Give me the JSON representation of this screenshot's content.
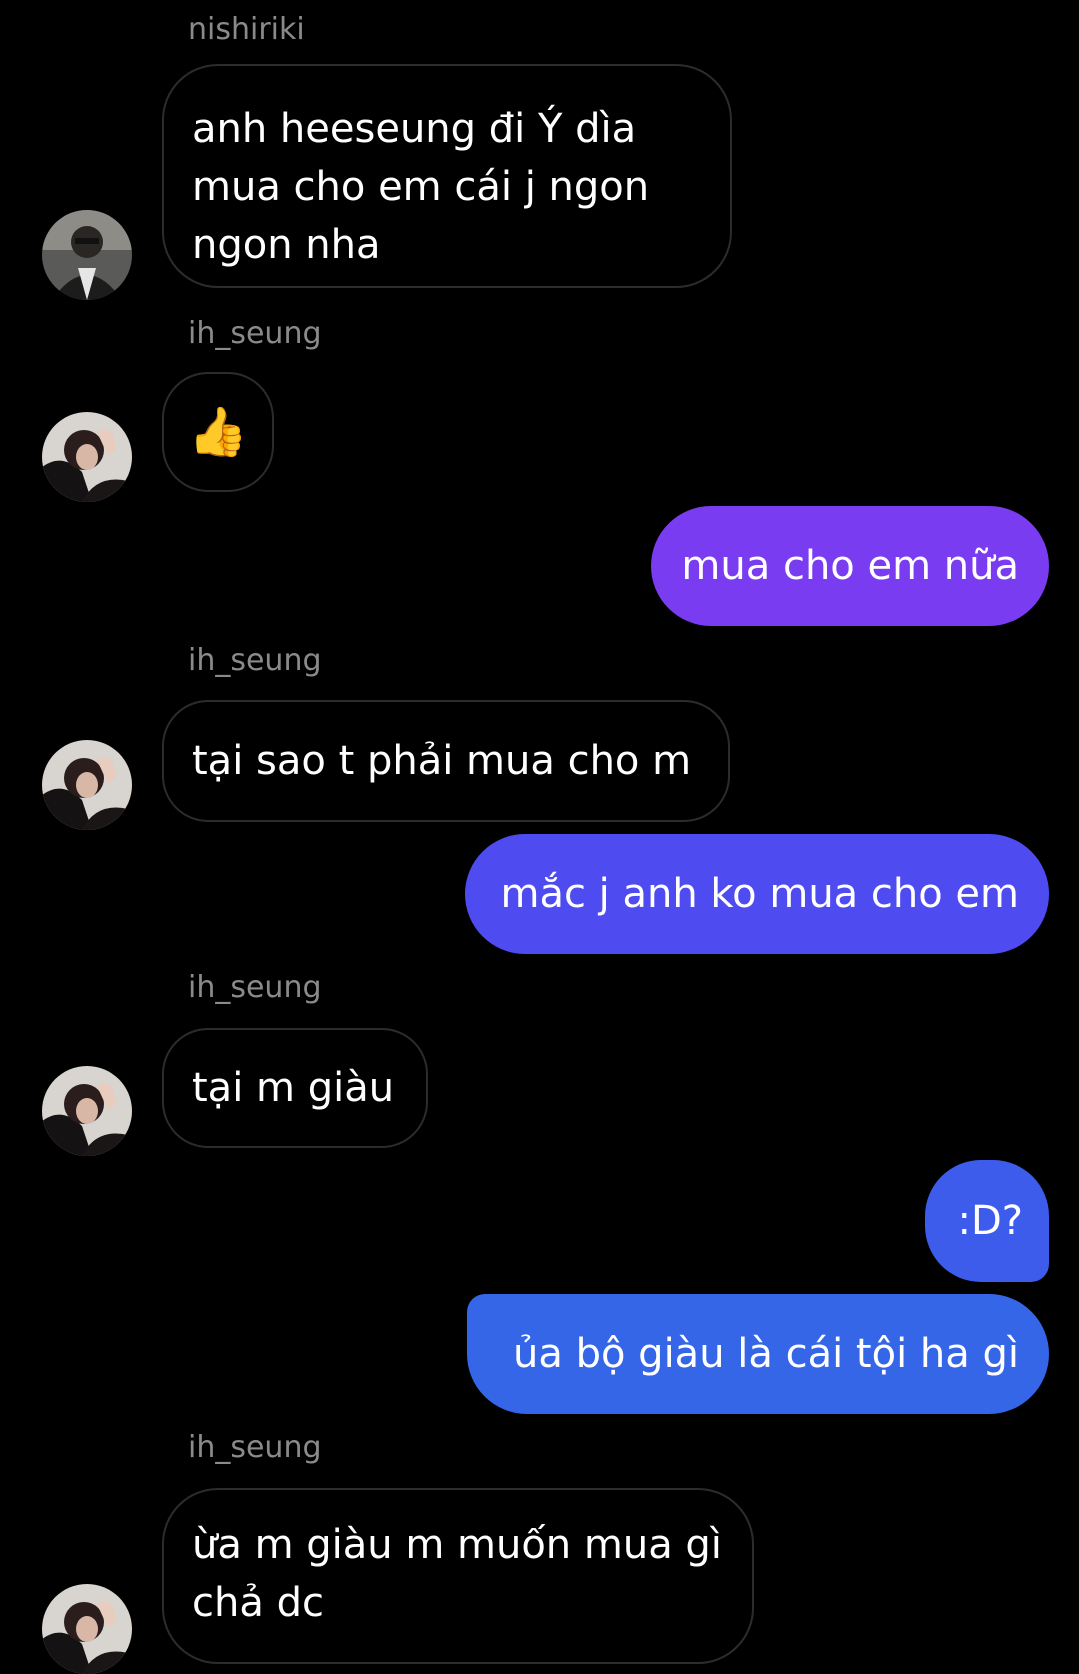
{
  "messages": [
    {
      "sender": "nishiriki",
      "text": "anh heeseung đi Ý dìa mua cho em cái j ngon ngon nha"
    },
    {
      "sender": "ih_seung",
      "reaction": "👍"
    },
    {
      "outgoing": "mua cho em nữa"
    },
    {
      "sender": "ih_seung",
      "text": "tại sao t phải mua cho m"
    },
    {
      "outgoing": "mắc j anh ko mua cho em"
    },
    {
      "sender": "ih_seung",
      "text": "tại m giàu"
    },
    {
      "outgoing": ":D?"
    },
    {
      "outgoing": "ủa bộ giàu là cái tội ha gì"
    },
    {
      "sender": "ih_seung",
      "text": "ừa m giàu m muốn mua gì chả dc"
    }
  ],
  "colors": {
    "background": "#000000",
    "incoming_border": "#2c2c2c",
    "outgoing_gradient_top": "#7a3cf0",
    "outgoing_gradient_bottom": "#3566e8",
    "sender_name": "#8a8a8a"
  },
  "icons": {
    "thumbs_up": "thumbs-up-emoji",
    "avatar_nishiriki": "avatar-nishiriki",
    "avatar_ih_seung": "avatar-ih-seung"
  }
}
